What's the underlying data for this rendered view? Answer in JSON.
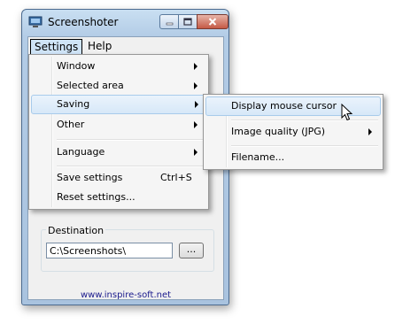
{
  "window": {
    "title": "Screenshoter"
  },
  "menubar": {
    "settings": "Settings",
    "help": "Help"
  },
  "settings_menu": {
    "items": [
      {
        "label": "Window",
        "submenu": true
      },
      {
        "label": "Selected area",
        "submenu": true
      },
      {
        "label": "Saving",
        "submenu": true,
        "highlighted": true
      },
      {
        "label": "Other",
        "submenu": true
      },
      {
        "label": "Language",
        "submenu": true
      },
      {
        "label": "Save settings",
        "shortcut": "Ctrl+S"
      },
      {
        "label": "Reset settings..."
      }
    ]
  },
  "saving_submenu": {
    "items": [
      {
        "label": "Display mouse cursor",
        "highlighted": true
      },
      {
        "label": "Image quality (JPG)",
        "submenu": true
      },
      {
        "label": "Filename..."
      }
    ]
  },
  "destination": {
    "label": "Destination",
    "value": "C:\\Screenshots\\",
    "browse": "..."
  },
  "footer": {
    "link": "www.inspire-soft.net"
  }
}
